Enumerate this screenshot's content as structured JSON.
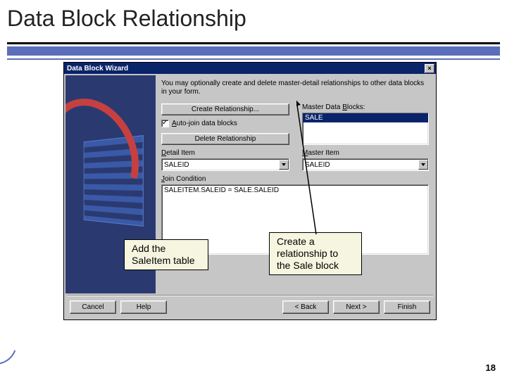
{
  "slide": {
    "title": "Data Block Relationship",
    "page_number": "18"
  },
  "dialog": {
    "title": "Data Block Wizard",
    "close_glyph": "×",
    "instructions": "You may optionally create and delete master-detail relationships to other data blocks in your form.",
    "labels": {
      "master_data_blocks": "Master Data Blocks:",
      "auto_join": "Auto-join data blocks",
      "detail_item": "Detail Item",
      "master_item": "Master Item",
      "join_condition": "Join Condition"
    },
    "buttons": {
      "create_relationship": "Create Relationship...",
      "delete_relationship": "Delete Relationship"
    },
    "values": {
      "master_block_selected": "SALE",
      "auto_join_checked": true,
      "detail_item": "SALEID",
      "master_item": "SALEID",
      "join_condition": "SALEITEM.SALEID = SALE.SALEID"
    },
    "footer": {
      "cancel": "Cancel",
      "help": "Help",
      "back": "< Back",
      "next": "Next >",
      "finish": "Finish"
    }
  },
  "callouts": {
    "left": "Add the SaleItem table",
    "right": "Create a relationship to the Sale block"
  }
}
